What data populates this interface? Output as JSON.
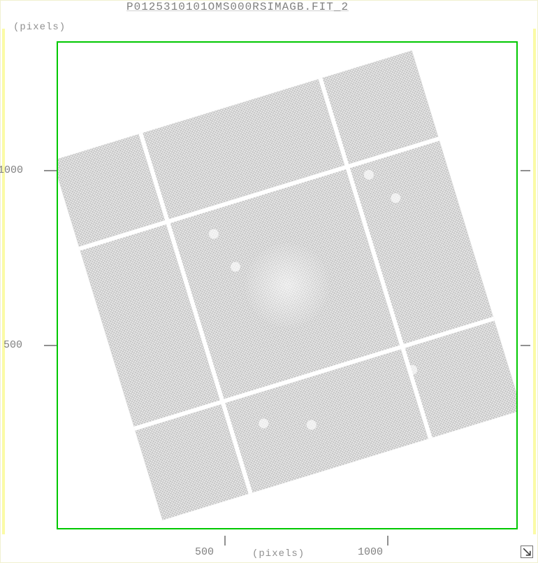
{
  "title": "P0125310101OMS000RSIMAGB.FIT_2",
  "axes": {
    "x_label": "(pixels)",
    "y_label": "(pixels)",
    "x_ticks": [
      "500",
      "1000"
    ],
    "y_ticks": [
      "1000",
      "500"
    ]
  },
  "icons": {
    "resize": "↘"
  }
}
